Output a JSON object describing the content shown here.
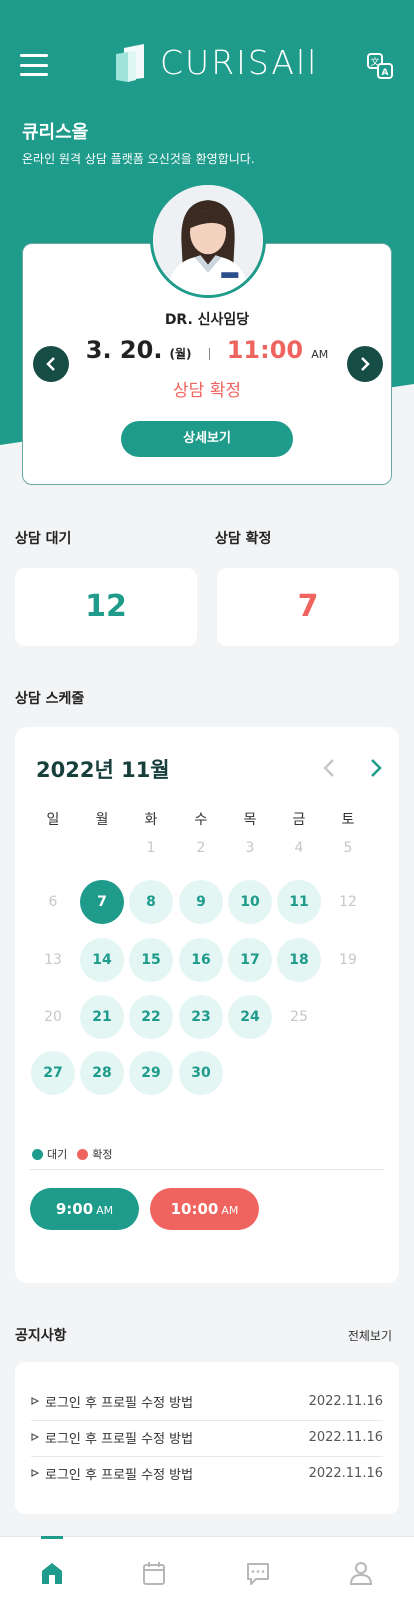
{
  "header": {
    "logo_text": "CURISAll",
    "menu_icon": "hamburger-menu-icon",
    "translate_icon": "translate-icon"
  },
  "welcome": {
    "brand": "큐리스올",
    "subtitle": "온라인 원격 상담 플랫폼 오신것을 환영합니다."
  },
  "appointment": {
    "doctor_name": "DR. 신사임당",
    "date": "3. 20.",
    "day_of_week": "(월)",
    "time": "11:00",
    "ampm": "AM",
    "status": "상담 확정",
    "detail_button": "상세보기"
  },
  "stats": {
    "waiting_label": "상담 대기",
    "waiting_count": "12",
    "confirmed_label": "상담 확정",
    "confirmed_count": "7"
  },
  "schedule": {
    "title": "상담 스케줄",
    "month": "2022년 11월",
    "weekdays": [
      "일",
      "월",
      "화",
      "수",
      "목",
      "금",
      "토"
    ],
    "weeks": [
      [
        null,
        null,
        1,
        2,
        3,
        4,
        5
      ],
      [
        6,
        7,
        8,
        9,
        10,
        11,
        12
      ],
      [
        13,
        14,
        15,
        16,
        17,
        18,
        19
      ],
      [
        20,
        21,
        22,
        23,
        24,
        25
      ],
      [
        27,
        28,
        29,
        30
      ]
    ],
    "selected_day": 7,
    "available_days": [
      8,
      9,
      10,
      11,
      14,
      15,
      16,
      17,
      18,
      21,
      22,
      23,
      24,
      27,
      28,
      29,
      30
    ],
    "legend": [
      {
        "label": "대기",
        "color": "#1e9b8b"
      },
      {
        "label": "확정",
        "color": "#f0645f"
      }
    ],
    "time_slots": [
      {
        "time": "9:00",
        "ampm": "AM",
        "color": "#1e9b8b"
      },
      {
        "time": "10:00",
        "ampm": "AM",
        "color": "#f0645f"
      }
    ]
  },
  "notices": {
    "title": "공지사항",
    "view_all": "전체보기",
    "items": [
      {
        "title": "로그인 후 프로필 수정 방법",
        "date": "2022.11.16"
      },
      {
        "title": "로그인 후 프로필 수정 방법",
        "date": "2022.11.16"
      },
      {
        "title": "로그인 후 프로필 수정 방법",
        "date": "2022.11.16"
      }
    ]
  },
  "colors": {
    "primary": "#1e9b8b",
    "accent": "#f0645f",
    "dark": "#174d47"
  }
}
